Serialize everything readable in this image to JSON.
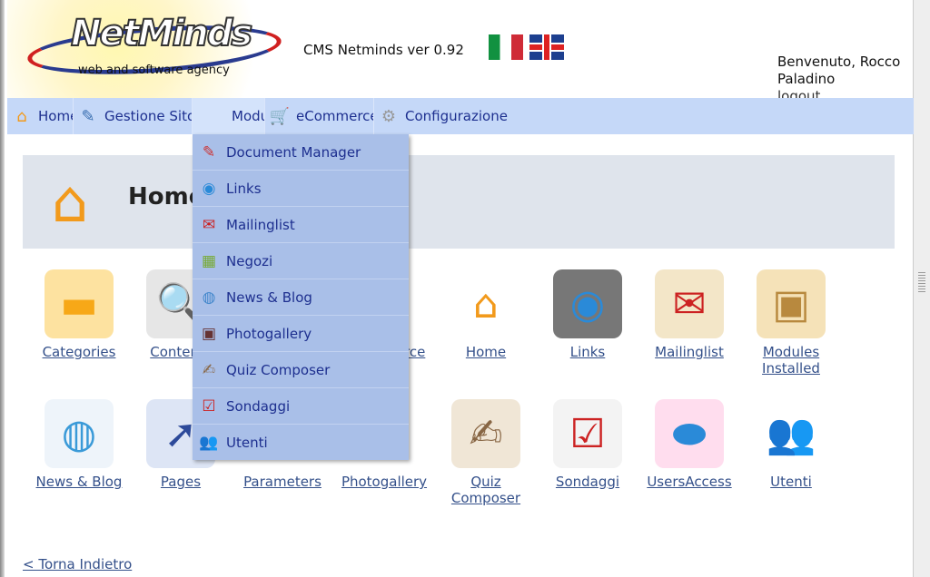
{
  "logo": {
    "name": "NetMinds",
    "tagline": "web and software agency"
  },
  "header": {
    "cms_version": "CMS Netminds ver 0.92",
    "welcome": "Benvenuto, Rocco Paladino",
    "logout": "logout",
    "flags": [
      {
        "icon": "italy-flag-icon"
      },
      {
        "icon": "uk-flag-icon"
      }
    ]
  },
  "menu": [
    {
      "label": "Home",
      "icon": "house-icon"
    },
    {
      "label": "Gestione Sito",
      "icon": "pencil-globe-icon"
    },
    {
      "label": "Moduli",
      "icon": "none"
    },
    {
      "label": "eCommerce",
      "icon": "cart-icon"
    },
    {
      "label": "Configurazione",
      "icon": "gear-icon"
    }
  ],
  "dropdown": [
    {
      "label": "Document Manager",
      "icon": "document-pencil-icon"
    },
    {
      "label": "Links",
      "icon": "globe-folder-icon"
    },
    {
      "label": "Mailinglist",
      "icon": "mail-plane-icon"
    },
    {
      "label": "Negozi",
      "icon": "shop-icon"
    },
    {
      "label": "News & Blog",
      "icon": "news-icon"
    },
    {
      "label": "Photogallery",
      "icon": "camera-icon"
    },
    {
      "label": "Quiz Composer",
      "icon": "clipboard-icon"
    },
    {
      "label": "Sondaggi",
      "icon": "checklist-icon"
    },
    {
      "label": "Utenti",
      "icon": "users-icon"
    }
  ],
  "page": {
    "title": "Home",
    "back": "< Torna Indietro"
  },
  "tiles": [
    {
      "label": "Categories",
      "icon": "folder-icon"
    },
    {
      "label": "Contents",
      "icon": "content-search-icon"
    },
    {
      "label": "",
      "icon": "unknown-icon"
    },
    {
      "label": "eCommerce",
      "icon": "ecommerce-icon"
    },
    {
      "label": "Home",
      "icon": "house-icon"
    },
    {
      "label": "Links",
      "icon": "globe-folder-icon"
    },
    {
      "label": "Mailinglist",
      "icon": "mail-plane-icon"
    },
    {
      "label": "Modules Installed",
      "icon": "box-icon"
    },
    {
      "label": "News & Blog",
      "icon": "news-icon"
    },
    {
      "label": "Pages",
      "icon": "pages-icon"
    },
    {
      "label": "Parameters",
      "icon": "parameters-icon"
    },
    {
      "label": "Photogallery",
      "icon": "camera-icon"
    },
    {
      "label": "Quiz Composer",
      "icon": "clipboard-icon"
    },
    {
      "label": "Sondaggi",
      "icon": "checklist-icon"
    },
    {
      "label": "UsersAccess",
      "icon": "users-access-icon"
    },
    {
      "label": "Utenti",
      "icon": "users-icon"
    }
  ],
  "colors": {
    "menubar": "#c5d8f8",
    "dropdown": "#a9bfe8",
    "link": "#34508a",
    "menu_text": "#1d2f8f"
  }
}
